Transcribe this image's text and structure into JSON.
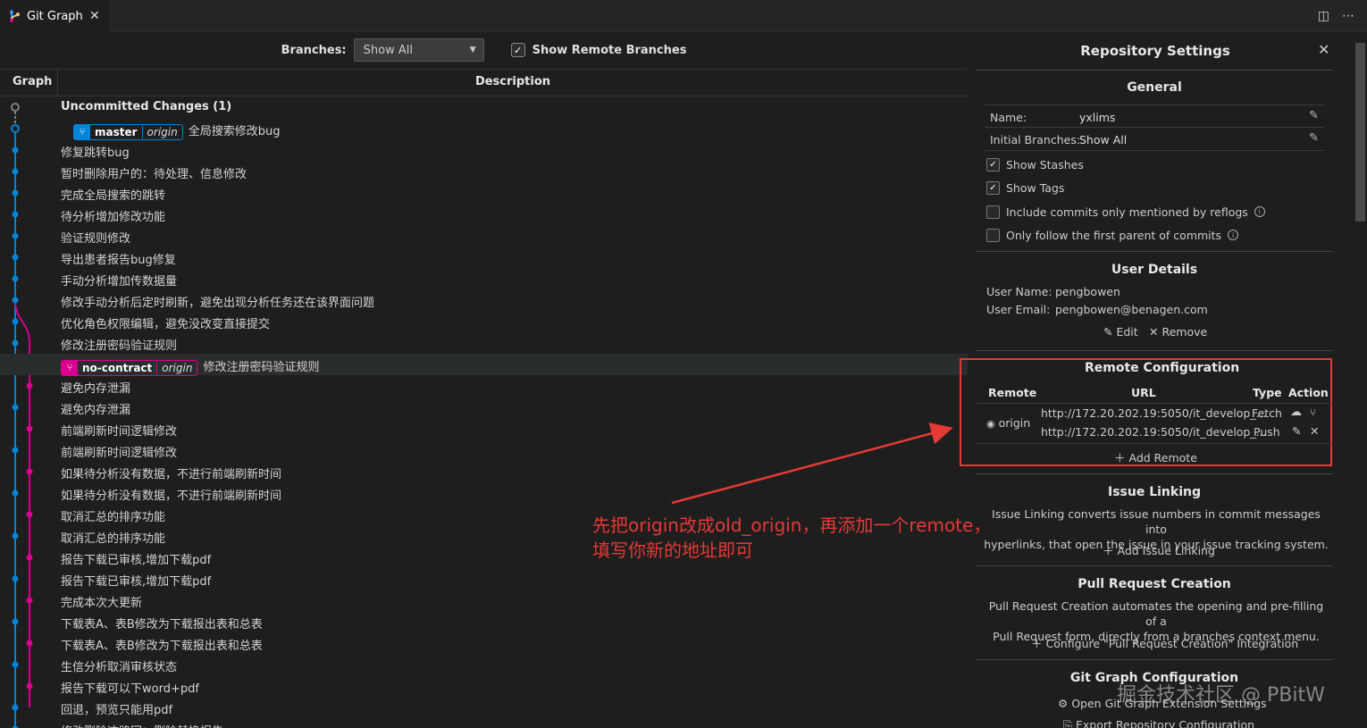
{
  "tab": {
    "title": "Git Graph",
    "close": "✕"
  },
  "tabbar_right": {
    "split": "◫",
    "more": "⋯"
  },
  "controls": {
    "branches_label": "Branches:",
    "branches_value": "Show All",
    "show_remote_label": "Show Remote Branches",
    "show_remote_checked": "✓"
  },
  "table_header": {
    "graph": "Graph",
    "description": "Description"
  },
  "commits": [
    {
      "text": "Uncommitted Changes (1)"
    },
    {
      "text": "全局搜索修改bug",
      "ref": "master",
      "remote": "origin",
      "ref_color": "blue"
    },
    {
      "text": "修复跳转bug"
    },
    {
      "text": "暂时删除用户的：待处理、信息修改"
    },
    {
      "text": "完成全局搜索的跳转"
    },
    {
      "text": "待分析增加修改功能"
    },
    {
      "text": "验证规则修改"
    },
    {
      "text": "导出患者报告bug修复"
    },
    {
      "text": "手动分析增加传数据量"
    },
    {
      "text": "修改手动分析后定时刷新，避免出现分析任务还在该界面问题"
    },
    {
      "text": "优化角色权限编辑，避免没改变直接提交"
    },
    {
      "text": "修改注册密码验证规则"
    },
    {
      "text": "修改注册密码验证规则",
      "ref": "no-contract",
      "remote": "origin",
      "ref_color": "pink"
    },
    {
      "text": "避免内存泄漏"
    },
    {
      "text": "避免内存泄漏"
    },
    {
      "text": "前端刷新时间逻辑修改"
    },
    {
      "text": "前端刷新时间逻辑修改"
    },
    {
      "text": "如果待分析没有数据，不进行前端刷新时间"
    },
    {
      "text": "如果待分析没有数据，不进行前端刷新时间"
    },
    {
      "text": "取消汇总的排序功能"
    },
    {
      "text": "取消汇总的排序功能"
    },
    {
      "text": "报告下载已审核,增加下载pdf"
    },
    {
      "text": "报告下载已审核,增加下载pdf"
    },
    {
      "text": "完成本次大更新"
    },
    {
      "text": "下载表A、表B修改为下载报出表和总表"
    },
    {
      "text": "下载表A、表B修改为下载报出表和总表"
    },
    {
      "text": "生信分析取消审核状态"
    },
    {
      "text": "报告下载可以下word+pdf"
    },
    {
      "text": "回退，预览只能用pdf"
    },
    {
      "text": "修改删除这路回：删除替换报告"
    }
  ],
  "settings": {
    "title": "Repository Settings",
    "close": "✕",
    "general": {
      "heading": "General",
      "name_label": "Name:",
      "name_value": "yxlims",
      "branches_label": "Initial Branches:",
      "branches_value": "Show All",
      "edit_icon": "✎",
      "options": [
        {
          "label": "Show Stashes",
          "checked": "✓"
        },
        {
          "label": "Show Tags",
          "checked": "✓"
        },
        {
          "label": "Include commits only mentioned by reflogs",
          "checked": ""
        },
        {
          "label": "Only follow the first parent of commits",
          "checked": ""
        }
      ],
      "info_icon": "i"
    },
    "user": {
      "heading": "User Details",
      "name_label": "User Name:",
      "name_value": "pengbowen",
      "email_label": "User Email:",
      "email_value": "pengbowen@benagen.com",
      "edit": "Edit",
      "remove": "Remove"
    },
    "remote": {
      "heading": "Remote Configuration",
      "col_remote": "Remote",
      "col_url": "URL",
      "col_type": "Type",
      "col_action": "Action",
      "name": "origin",
      "fetch_url": "http://172.20.202.19:5050/it_develop_...",
      "push_url": "http://172.20.202.19:5050/it_develop_...",
      "fetch": "Fetch",
      "push": "Push",
      "add": "Add Remote"
    },
    "issue": {
      "heading": "Issue Linking",
      "desc1": "Issue Linking converts issue numbers in commit messages into",
      "desc2": "hyperlinks, that open the issue in your issue tracking system.",
      "add": "Add Issue Linking"
    },
    "pr": {
      "heading": "Pull Request Creation",
      "desc1": "Pull Request Creation automates the opening and pre-filling of a",
      "desc2": "Pull Request form, directly from a branches context menu.",
      "configure": "Configure \"Pull Request Creation\" Integration"
    },
    "config": {
      "heading": "Git Graph Configuration",
      "open": "Open Git Graph Extension Settings",
      "export": "Export Repository Configuration"
    }
  },
  "annotation": {
    "line1": "先把origin改成old_origin，再添加一个remote，",
    "line2": "填写你新的地址即可"
  },
  "watermark": "掘金技术社区 @ PBitW",
  "colors": {
    "blue": "#0085d9",
    "pink": "#d9008f",
    "annot": "#e53935"
  }
}
